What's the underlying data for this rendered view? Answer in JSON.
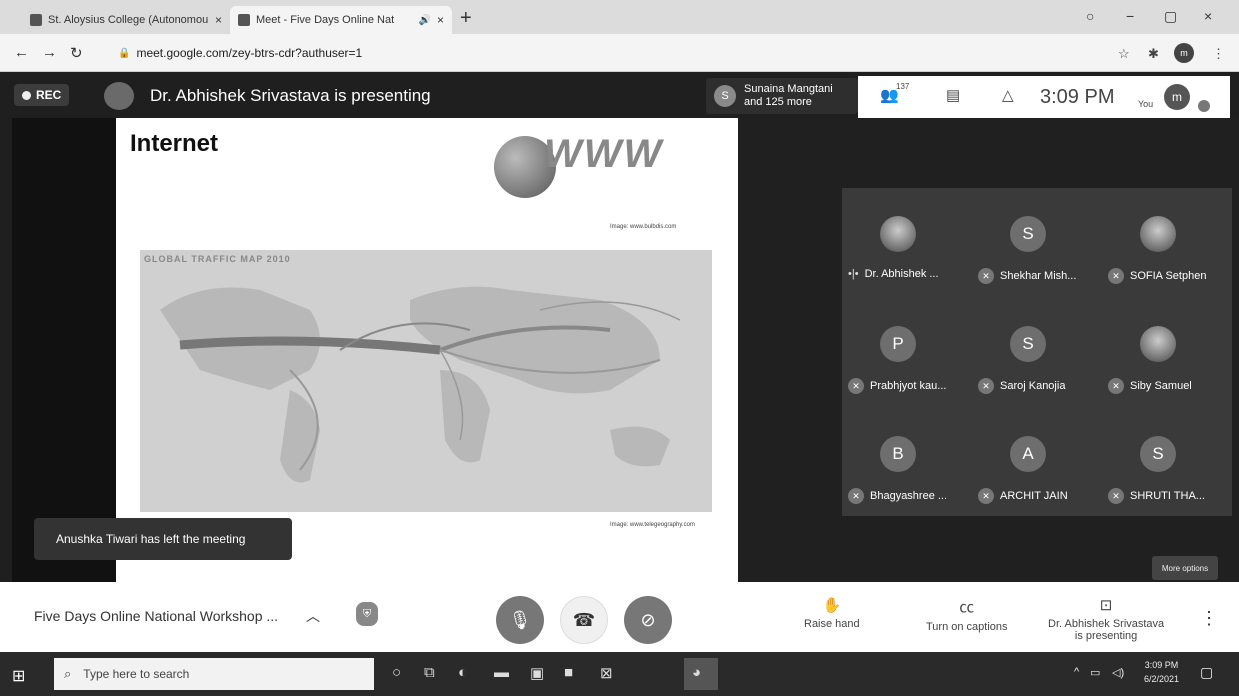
{
  "browser": {
    "tabs": [
      {
        "title": "St. Aloysius College (Autonomou",
        "close": "×"
      },
      {
        "title": "Meet - Five Days Online Nat",
        "close": "×",
        "audio": "🔊"
      }
    ],
    "new_tab": "+",
    "window_controls": [
      "○",
      "−",
      "▢",
      "×"
    ],
    "url": "meet.google.com/zey-btrs-cdr?authuser=1",
    "profile_initial": "m"
  },
  "meet": {
    "rec_label": "REC",
    "presenting_banner": "Dr. Abhishek Srivastava is presenting",
    "joiner": {
      "initial": "S",
      "line1": "Sunaina Mangtani",
      "line2": "and 125 more"
    },
    "participant_count": "137",
    "clock": "3:09 PM",
    "you_label": "You",
    "you_initial": "m",
    "slide": {
      "title": "Internet",
      "logo_text": "WWW",
      "caption1": "Image: www.bulbdis.com",
      "map_title": "GLOBAL TRAFFIC MAP 2010",
      "caption2": "Image: www.telegeography.com"
    },
    "participants": [
      {
        "name": "Dr. Abhishek ...",
        "initial": "",
        "photo": true,
        "speaking": true
      },
      {
        "name": "Shekhar Mish...",
        "initial": "S",
        "photo": false,
        "speaking": false
      },
      {
        "name": "SOFIA Setphen",
        "initial": "",
        "photo": true,
        "speaking": false
      },
      {
        "name": "Prabhjyot kau...",
        "initial": "P",
        "photo": false,
        "speaking": false
      },
      {
        "name": "Saroj Kanojia",
        "initial": "S",
        "photo": false,
        "speaking": false
      },
      {
        "name": "Siby Samuel",
        "initial": "",
        "photo": true,
        "speaking": false
      },
      {
        "name": "Bhagyashree ...",
        "initial": "B",
        "photo": false,
        "speaking": false
      },
      {
        "name": "ARCHIT JAIN",
        "initial": "A",
        "photo": false,
        "speaking": false
      },
      {
        "name": "SHRUTI THA...",
        "initial": "S",
        "photo": false,
        "speaking": false
      }
    ],
    "toast": "Anushka Tiwari has left the meeting",
    "more_options": "More options",
    "bottom": {
      "meeting_title": "Five Days Online National Workshop ...",
      "raise_hand": "Raise hand",
      "captions": "Turn on captions",
      "presenting_line1": "Dr. Abhishek Srivastava",
      "presenting_line2": "is presenting"
    }
  },
  "taskbar": {
    "search_placeholder": "Type here to search",
    "time": "3:09 PM",
    "date": "6/2/2021"
  }
}
